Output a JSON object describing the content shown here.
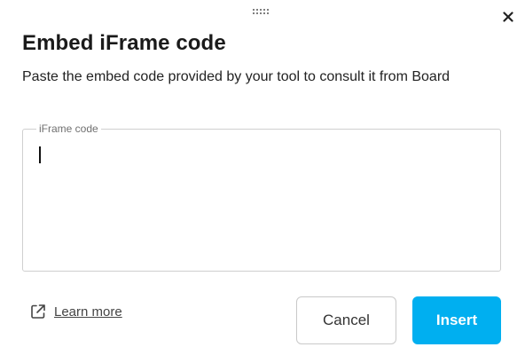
{
  "dialog": {
    "title": "Embed iFrame code",
    "description": "Paste the embed code provided by your tool to consult it from Board",
    "field": {
      "label": "iFrame code",
      "value": "",
      "placeholder": ""
    },
    "learn_more": {
      "label": "Learn more",
      "icon": "external-link-icon"
    },
    "buttons": {
      "cancel_label": "Cancel",
      "insert_label": "Insert"
    },
    "icons": {
      "close": "close-icon",
      "drag": "drag-handle-icon"
    },
    "colors": {
      "primary": "#00aff0",
      "border": "#cfcfcf",
      "text": "#1a1a1a"
    }
  }
}
